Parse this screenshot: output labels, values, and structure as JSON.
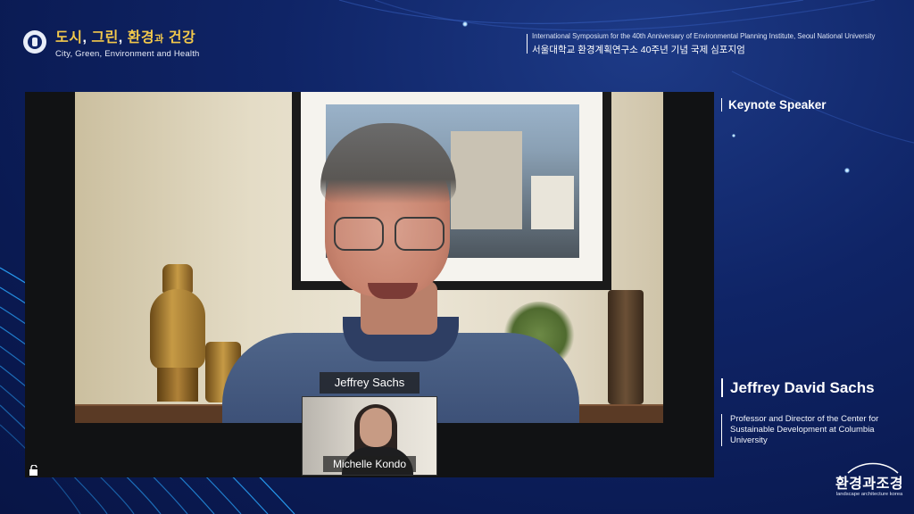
{
  "header": {
    "title_ko_parts": [
      "도시",
      "그린",
      "환경",
      "과",
      "건강"
    ],
    "title_en": "City, Green, Environment and Health",
    "symposium_en": "International Symposium for the 40th Anniversary of Environmental Planning Institute, Seoul National University",
    "symposium_ko": "서울대학교 환경계획연구소 40주년 기념 국제 심포지엄"
  },
  "video": {
    "main_participant": "Jeffrey Sachs",
    "thumbnail_participant": "Michelle Kondo"
  },
  "speaker": {
    "section_label": "Keynote Speaker",
    "name": "Jeffrey David Sachs",
    "description": "Professor and Director of the Center for Sustainable Development at Columbia University"
  },
  "brand": {
    "name_ko": "환경과조경",
    "name_en": "landscape architecture korea"
  },
  "colors": {
    "background": "#0f2466",
    "title_accent": "#f2c84b"
  }
}
